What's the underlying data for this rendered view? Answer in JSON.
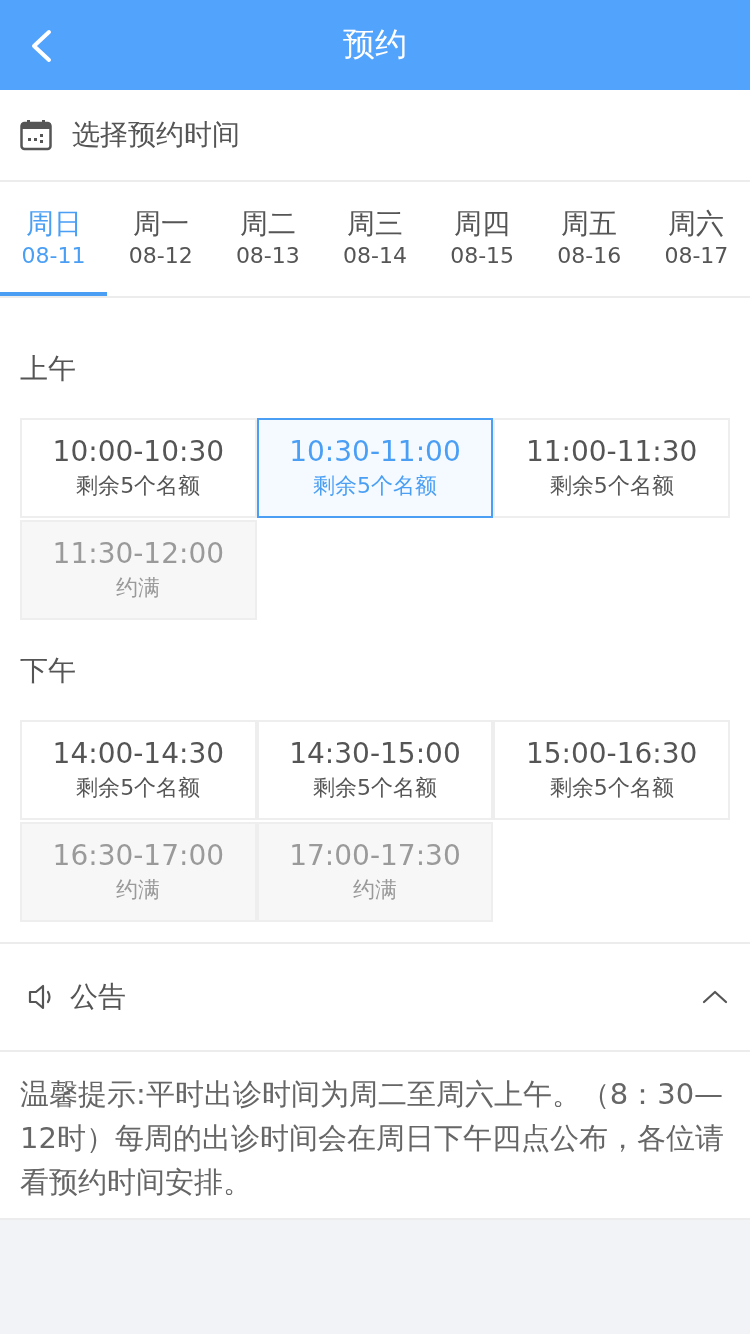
{
  "header": {
    "title": "预约"
  },
  "section": {
    "title": "选择预约时间"
  },
  "days": [
    {
      "weekday": "周日",
      "date": "08-11",
      "selected": true
    },
    {
      "weekday": "周一",
      "date": "08-12",
      "selected": false
    },
    {
      "weekday": "周二",
      "date": "08-13",
      "selected": false
    },
    {
      "weekday": "周三",
      "date": "08-14",
      "selected": false
    },
    {
      "weekday": "周四",
      "date": "08-15",
      "selected": false
    },
    {
      "weekday": "周五",
      "date": "08-16",
      "selected": false
    },
    {
      "weekday": "周六",
      "date": "08-17",
      "selected": false
    }
  ],
  "periods": [
    {
      "label": "上午",
      "slots": [
        {
          "time": "10:00-10:30",
          "status": "剩余5个名额",
          "full": false,
          "selected": false
        },
        {
          "time": "10:30-11:00",
          "status": "剩余5个名额",
          "full": false,
          "selected": true
        },
        {
          "time": "11:00-11:30",
          "status": "剩余5个名额",
          "full": false,
          "selected": false
        },
        {
          "time": "11:30-12:00",
          "status": "约满",
          "full": true,
          "selected": false
        }
      ]
    },
    {
      "label": "下午",
      "slots": [
        {
          "time": "14:00-14:30",
          "status": "剩余5个名额",
          "full": false,
          "selected": false
        },
        {
          "time": "14:30-15:00",
          "status": "剩余5个名额",
          "full": false,
          "selected": false
        },
        {
          "time": "15:00-16:30",
          "status": "剩余5个名额",
          "full": false,
          "selected": false
        },
        {
          "time": "16:30-17:00",
          "status": "约满",
          "full": true,
          "selected": false
        },
        {
          "time": "17:00-17:30",
          "status": "约满",
          "full": true,
          "selected": false
        }
      ]
    }
  ],
  "notice": {
    "title": "公告",
    "expanded": true,
    "text": "温馨提示:平时出诊时间为周二至周六上午。（8：30—12时）每周的出诊时间会在周日下午四点公布，各位请看预约时间安排。"
  }
}
